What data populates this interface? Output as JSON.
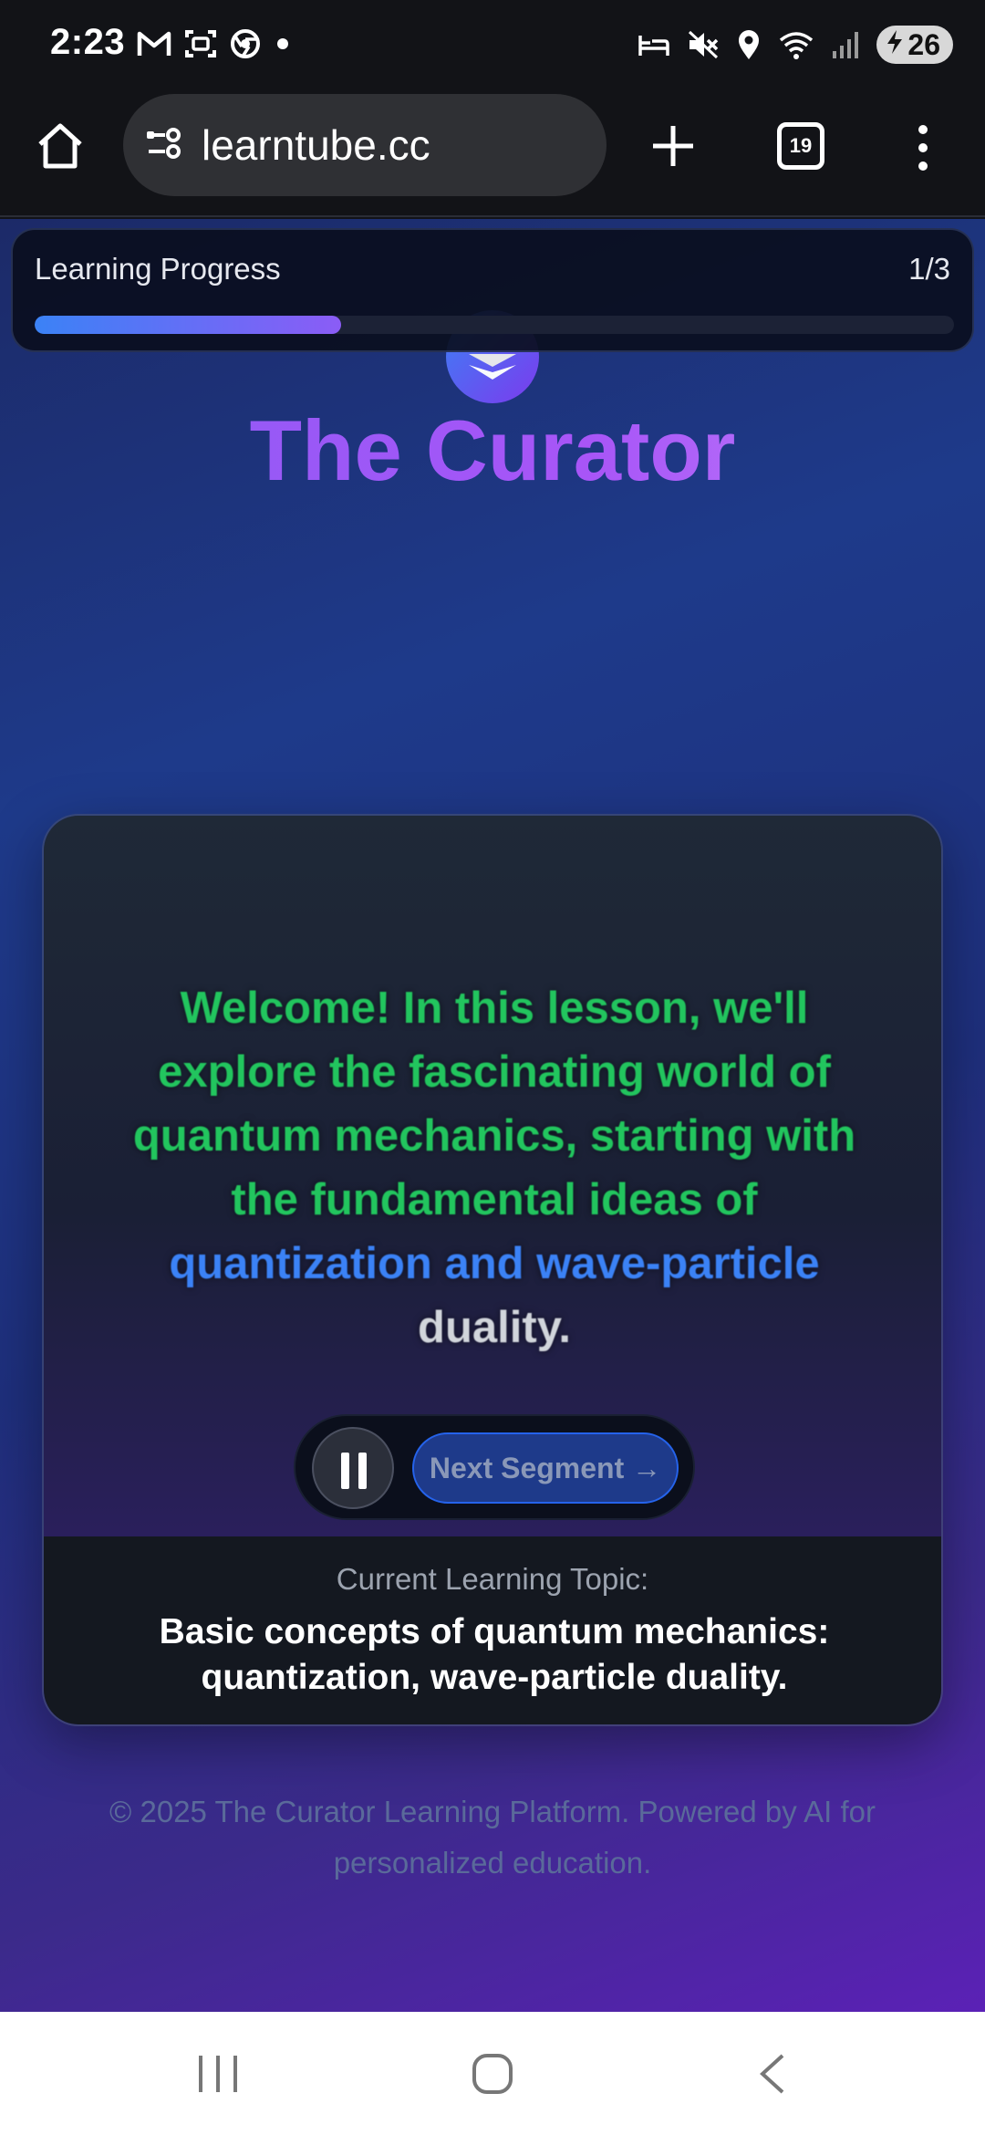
{
  "status_bar": {
    "time": "2:23",
    "battery": "26",
    "left_icons": [
      "gmail-icon",
      "screenshot-icon",
      "chrome-icon",
      "dot-icon"
    ],
    "right_icons": [
      "bed-icon",
      "mute-icon",
      "location-icon",
      "wifi-icon",
      "signal-icon",
      "battery-icon"
    ]
  },
  "browser": {
    "url": "learntube.cc",
    "tab_count": "19"
  },
  "progress": {
    "label": "Learning Progress",
    "count": "1/3",
    "fraction": 0.333,
    "colors": {
      "start": "#3b82f6",
      "end": "#8b5cf6"
    }
  },
  "header": {
    "title": "The Curator"
  },
  "lesson": {
    "subtitle_green": "Welcome!  In this lesson, we'll explore the fascinating world of quantum mechanics, starting with the fundamental ideas of",
    "subtitle_blue": "quantization and wave-particle",
    "subtitle_gray": "duality.",
    "next_label": "Next Segment →",
    "topic_label": "Current Learning Topic:",
    "topic_text": "Basic concepts of quantum mechanics: quantization, wave-particle duality.",
    "colors": {
      "spoken": "#22c55e",
      "current": "#3b82f6",
      "upcoming": "#d1d5db"
    }
  },
  "footer": {
    "text": "© 2025 The Curator Learning Platform. Powered by AI for personalized education."
  }
}
